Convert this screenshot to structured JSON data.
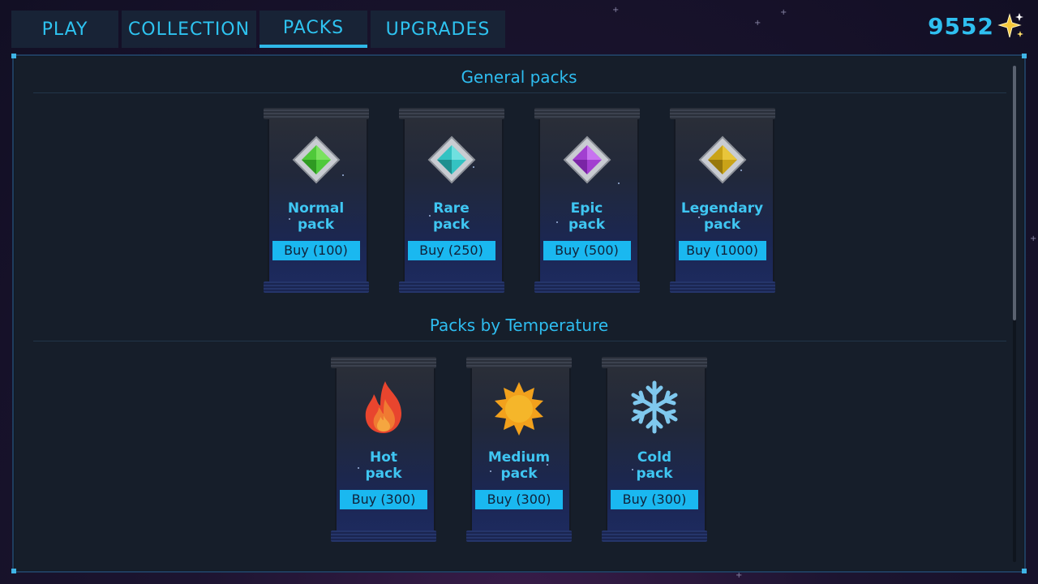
{
  "nav": {
    "tabs": [
      {
        "label": "PLAY"
      },
      {
        "label": "COLLECTION"
      },
      {
        "label": "PACKS"
      },
      {
        "label": "UPGRADES"
      }
    ],
    "active_tab": "PACKS"
  },
  "currency": {
    "value": "9552",
    "icon": "sparkle-icon"
  },
  "sections": [
    {
      "title": "General packs",
      "packs": [
        {
          "name_line1": "Normal",
          "name_line2": "pack",
          "buy_label": "Buy (100)",
          "gem_color": "#4fc93a",
          "icon": "green-gem-icon"
        },
        {
          "name_line1": "Rare",
          "name_line2": "pack",
          "buy_label": "Buy (250)",
          "gem_color": "#34c2c2",
          "icon": "teal-gem-icon"
        },
        {
          "name_line1": "Epic",
          "name_line2": "pack",
          "buy_label": "Buy (500)",
          "gem_color": "#a23fd0",
          "icon": "purple-gem-icon"
        },
        {
          "name_line1": "Legendary",
          "name_line2": "pack",
          "buy_label": "Buy (1000)",
          "gem_color": "#c9a318",
          "icon": "gold-gem-icon"
        }
      ]
    },
    {
      "title": "Packs by Temperature",
      "packs": [
        {
          "name_line1": "Hot",
          "name_line2": "pack",
          "buy_label": "Buy (300)",
          "icon": "flame-icon"
        },
        {
          "name_line1": "Medium",
          "name_line2": "pack",
          "buy_label": "Buy (300)",
          "icon": "sun-icon"
        },
        {
          "name_line1": "Cold",
          "name_line2": "pack",
          "buy_label": "Buy (300)",
          "icon": "snowflake-icon"
        }
      ]
    }
  ],
  "colors": {
    "accent": "#2fbff0",
    "button": "#1ab8f0",
    "panel": "#161e2a"
  }
}
